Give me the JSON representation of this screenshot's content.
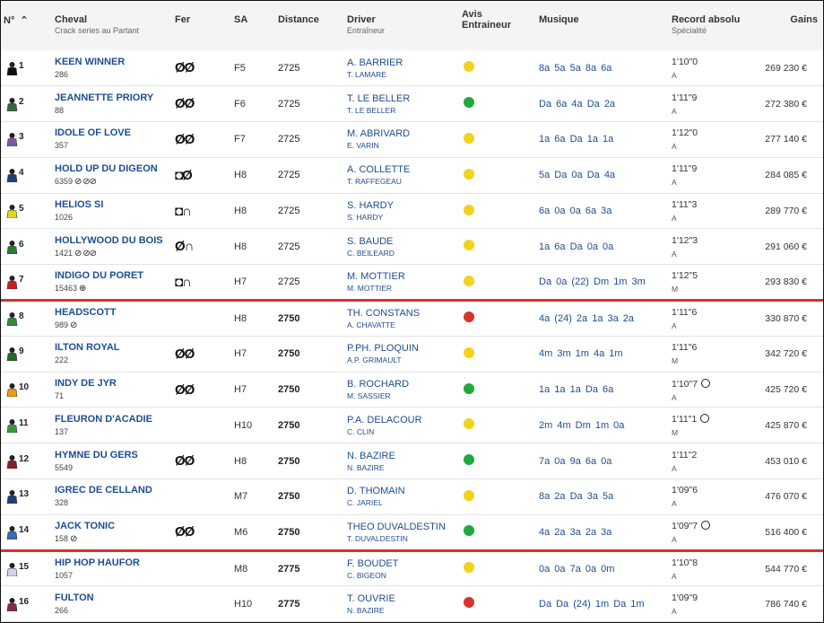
{
  "headers": {
    "num": "N°",
    "cheval": "Cheval",
    "cheval_sub": "Crack series au Partant",
    "fer": "Fer",
    "sa": "SA",
    "distance": "Distance",
    "driver": "Driver",
    "driver_sub": "Entraîneur",
    "avis1": "Avis",
    "avis2": "Entraineur",
    "musique": "Musique",
    "record": "Record absolu",
    "record_sub": "Spécialité",
    "gains": "Gains"
  },
  "icons": {
    "sort": "chevron-up-icon",
    "jockey": "jockey-silk-icon",
    "clock": "stopwatch-icon",
    "avis": "smiley-icon"
  },
  "colors": {
    "accent_blue": "#1d4e91",
    "separator_red": "#d9302b",
    "avis_yellow": "#f2d21b",
    "avis_green": "#1fa83c",
    "avis_red": "#d8322a"
  },
  "rows": [
    {
      "num": "1",
      "name": "KEEN WINNER",
      "stat": "286",
      "mini": "",
      "fer": "ØØ",
      "sa": "F5",
      "dist": "2725",
      "driver": "A. BARRIER",
      "trainer": "T. LAMARE",
      "avis": "y",
      "mus": "8a 5a 5a 8a 6a",
      "rec": "1'10\"0",
      "spec": "A",
      "gain": "269 230 €",
      "silk": "#111111",
      "sep": false
    },
    {
      "num": "2",
      "name": "JEANNETTE PRIORY",
      "stat": "88",
      "mini": "",
      "fer": "ØØ",
      "sa": "F6",
      "dist": "2725",
      "driver": "T. LE BELLER",
      "trainer": "T. LE BELLER",
      "avis": "g",
      "mus": "Da 6a 4a Da 2a",
      "rec": "1'11\"9",
      "spec": "A",
      "gain": "272 380 €",
      "silk": "#2f6b3a",
      "sep": false
    },
    {
      "num": "3",
      "name": "IDOLE OF LOVE",
      "stat": "357",
      "mini": "",
      "fer": "ØØ",
      "sa": "F7",
      "dist": "2725",
      "driver": "M. ABRIVARD",
      "trainer": "E. VARIN",
      "avis": "y",
      "mus": "1a 6a Da 1a 1a",
      "rec": "1'12\"0",
      "spec": "A",
      "gain": "277 140 €",
      "silk": "#7a5aa8",
      "sep": false
    },
    {
      "num": "4",
      "name": "HOLD UP DU DIGEON",
      "stat": "6359",
      "mini": "⊘ ⊘⊘",
      "fer": "◘Ø",
      "sa": "H8",
      "dist": "2725",
      "driver": "A. COLLETTE",
      "trainer": "T. RAFFEGEAU",
      "avis": "y",
      "mus": "5a Da 0a Da 4a",
      "rec": "1'11\"9",
      "spec": "A",
      "gain": "284 085 €",
      "silk": "#1d3f7a",
      "sep": false
    },
    {
      "num": "5",
      "name": "HELIOS SI",
      "stat": "1026",
      "mini": "",
      "fer": "◘∩",
      "sa": "H8",
      "dist": "2725",
      "driver": "S. HARDY",
      "trainer": "S. HARDY",
      "avis": "y",
      "mus": "6a 0a 0a 6a 3a",
      "rec": "1'11\"3",
      "spec": "A",
      "gain": "289 770 €",
      "silk": "#e6d21a",
      "sep": false
    },
    {
      "num": "6",
      "name": "HOLLYWOOD DU BOIS",
      "stat": "1421",
      "mini": "⊘ ⊘⊘",
      "fer": "Ø∩",
      "sa": "H8",
      "dist": "2725",
      "driver": "S. BAUDE",
      "trainer": "C. BEILEARD",
      "avis": "y",
      "mus": "1a 6a Da 0a 0a",
      "rec": "1'12\"3",
      "spec": "A",
      "gain": "291 060 €",
      "silk": "#2b7a2e",
      "sep": false
    },
    {
      "num": "7",
      "name": "INDIGO DU PORET",
      "stat": "15463",
      "mini": "⊕",
      "fer": "◘∩",
      "sa": "H7",
      "dist": "2725",
      "driver": "M. MOTTIER",
      "trainer": "M. MOTTIER",
      "avis": "y",
      "mus": "Da 0a (22) Dm 1m 3m",
      "rec": "1'12\"5",
      "spec": "M",
      "gain": "293 830 €",
      "silk": "#c81e1e",
      "sep": true
    },
    {
      "num": "8",
      "name": "HEADSCOTT",
      "stat": "989",
      "mini": "⊘",
      "fer": "",
      "sa": "H8",
      "dist": "2750",
      "driver": "TH. CONSTANS",
      "trainer": "A. CHAVATTE",
      "avis": "r",
      "mus": "4a (24) 2a 1a 3a 2a",
      "rec": "1'11\"6",
      "spec": "A",
      "gain": "330 870 €",
      "silk": "#2f8a3a",
      "sep": false
    },
    {
      "num": "9",
      "name": "ILTON ROYAL",
      "stat": "222",
      "mini": "",
      "fer": "ØØ",
      "sa": "H7",
      "dist": "2750",
      "driver": "P.PH. PLOQUIN",
      "trainer": "A.P. GRIMAULT",
      "avis": "y",
      "mus": "4m 3m 1m 4a 1m",
      "rec": "1'11\"6",
      "spec": "M",
      "gain": "342 720 €",
      "silk": "#1f6b2e",
      "sep": false
    },
    {
      "num": "10",
      "name": "INDY DE JYR",
      "stat": "71",
      "mini": "",
      "fer": "ØØ",
      "sa": "H7",
      "dist": "2750",
      "driver": "B. ROCHARD",
      "trainer": "M. SASSIER",
      "avis": "g",
      "mus": "1a 1a 1a Da 6a",
      "rec": "1'10\"7",
      "spec": "A",
      "gain": "425 720 €",
      "silk": "#e89a1a",
      "sep": false,
      "clock": true
    },
    {
      "num": "11",
      "name": "FLEURON D'ACADIE",
      "stat": "137",
      "mini": "",
      "fer": "",
      "sa": "H10",
      "dist": "2750",
      "driver": "P.A. DELACOUR",
      "trainer": "C. CLIN",
      "avis": "y",
      "mus": "2m 4m Dm 1m 0a",
      "rec": "1'11\"1",
      "spec": "M",
      "gain": "425 870 €",
      "silk": "#3a9a3a",
      "sep": false,
      "clock": true
    },
    {
      "num": "12",
      "name": "HYMNE DU GERS",
      "stat": "5549",
      "mini": "",
      "fer": "ØØ",
      "sa": "H8",
      "dist": "2750",
      "driver": "N. BAZIRE",
      "trainer": "N. BAZIRE",
      "avis": "g",
      "mus": "7a 0a 9a 6a 0a",
      "rec": "1'11\"2",
      "spec": "A",
      "gain": "453 010 €",
      "silk": "#8a1f2a",
      "sep": false
    },
    {
      "num": "13",
      "name": "IGREC DE CELLAND",
      "stat": "328",
      "mini": "",
      "fer": "",
      "sa": "M7",
      "dist": "2750",
      "driver": "D. THOMAIN",
      "trainer": "C. JARIEL",
      "avis": "y",
      "mus": "8a 2a Da 3a 5a",
      "rec": "1'09\"6",
      "spec": "A",
      "gain": "476 070 €",
      "silk": "#1d3f7a",
      "sep": false
    },
    {
      "num": "14",
      "name": "JACK TONIC",
      "stat": "158",
      "mini": "⊘",
      "fer": "ØØ",
      "sa": "M6",
      "dist": "2750",
      "driver": "THEO DUVALDESTIN",
      "trainer": "T. DUVALDESTIN",
      "avis": "g",
      "mus": "4a 2a 3a 2a 3a",
      "rec": "1'09\"7",
      "spec": "A",
      "gain": "516 400 €",
      "silk": "#3a6ab8",
      "sep": true,
      "clock": true
    },
    {
      "num": "15",
      "name": "HIP HOP HAUFOR",
      "stat": "1057",
      "mini": "",
      "fer": "",
      "sa": "M8",
      "dist": "2775",
      "driver": "F. BOUDET",
      "trainer": "C. BIGEON",
      "avis": "y",
      "mus": "0a 0a 7a 0a 0m",
      "rec": "1'10\"8",
      "spec": "A",
      "gain": "544 770 €",
      "silk": "#cfd6e6",
      "sep": false
    },
    {
      "num": "16",
      "name": "FULTON",
      "stat": "266",
      "mini": "",
      "fer": "",
      "sa": "H10",
      "dist": "2775",
      "driver": "T. OUVRIE",
      "trainer": "N. BAZIRE",
      "avis": "r",
      "mus": "Da Da (24) 1m Da 1m",
      "rec": "1'09\"9",
      "spec": "A",
      "gain": "786 740 €",
      "silk": "#8a2a4a",
      "sep": false
    }
  ]
}
